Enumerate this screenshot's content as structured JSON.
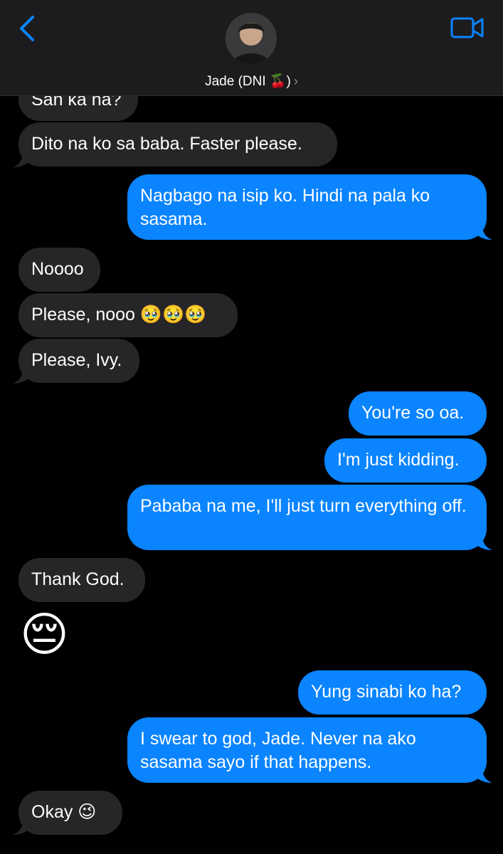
{
  "header": {
    "contact_name": "Jade (DNI 🍒)",
    "chevron": "›",
    "back_icon": "chevron-left-icon",
    "video_icon": "video-camera-icon",
    "accent": "#0a84ff"
  },
  "messages": [
    {
      "from": "them",
      "text": "San ka na?"
    },
    {
      "from": "them",
      "text": "Dito na ko sa baba. Faster please."
    },
    {
      "from": "me",
      "text": "Nagbago na isip ko. Hindi na pala ko sasama."
    },
    {
      "from": "them",
      "text": "Noooo"
    },
    {
      "from": "them",
      "text": "Please, nooo 🥹🥹🥹"
    },
    {
      "from": "them",
      "text": "Please, Ivy."
    },
    {
      "from": "me",
      "text": "You're so oa."
    },
    {
      "from": "me",
      "text": "I'm just kidding."
    },
    {
      "from": "me",
      "text": "Pababa na me, I'll just turn everything off."
    },
    {
      "from": "them",
      "text": "Thank God."
    },
    {
      "from": "them",
      "text": "😔"
    },
    {
      "from": "me",
      "text": "Yung sinabi ko ha?"
    },
    {
      "from": "me",
      "text": "I swear to god, Jade. Never na ako sasama sayo if that happens."
    },
    {
      "from": "them",
      "text": "Okay 😉"
    }
  ],
  "colors": {
    "incoming_bubble": "#262629",
    "outgoing_bubble": "#0a84ff",
    "header_bg": "#1c1c1e"
  }
}
